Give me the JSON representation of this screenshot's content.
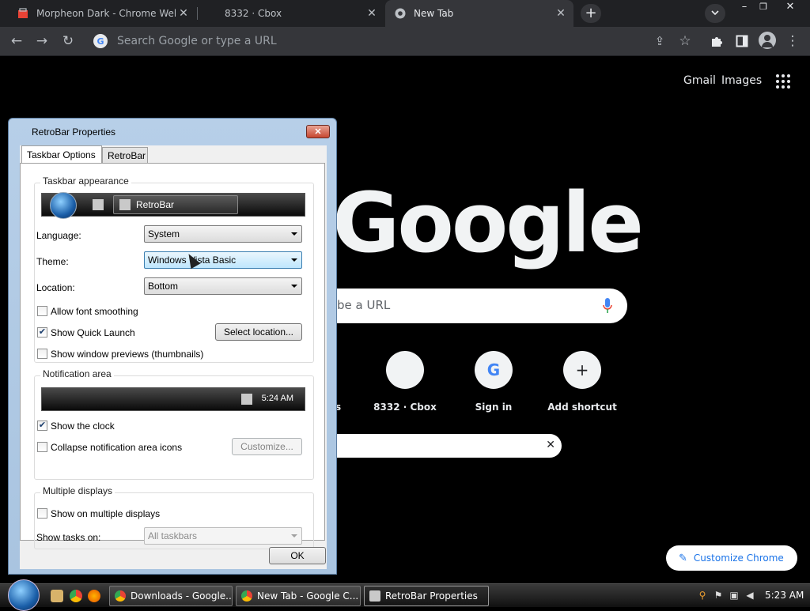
{
  "browser": {
    "tabs": [
      {
        "title": "Morpheon Dark - Chrome Web Store",
        "icon": "chrome-web-store-icon"
      },
      {
        "title": "8332 · Cbox",
        "icon": "blank-page-icon"
      },
      {
        "title": "New Tab",
        "icon": "chrome-icon"
      }
    ],
    "omnibox_placeholder": "Search Google or type a URL"
  },
  "ntp": {
    "gmail": "Gmail",
    "images": "Images",
    "logo": "Google",
    "search_placeholder_fragment": "be a URL",
    "partial_shortcut_label": "s",
    "shortcuts": [
      {
        "label": "8332 · Cbox",
        "glyph": ""
      },
      {
        "label": "Sign in",
        "glyph": "G"
      },
      {
        "label": "Add shortcut",
        "glyph": "+"
      }
    ],
    "customize_label": "Customize Chrome"
  },
  "dialog": {
    "title": "RetroBar Properties",
    "tabs": [
      "Taskbar Options",
      "RetroBar"
    ],
    "appearance": {
      "group_label": "Taskbar appearance",
      "preview_task": "RetroBar"
    },
    "language": {
      "label": "Language:",
      "value": "System"
    },
    "theme": {
      "label": "Theme:",
      "value": "Windows Vista Basic"
    },
    "location": {
      "label": "Location:",
      "value": "Bottom"
    },
    "checks": {
      "font_smoothing": {
        "label": "Allow font smoothing",
        "checked": false
      },
      "quick_launch": {
        "label": "Show Quick Launch",
        "checked": true
      },
      "previews": {
        "label": "Show window previews (thumbnails)",
        "checked": false
      }
    },
    "select_location_label": "Select location...",
    "notification": {
      "group_label": "Notification area",
      "preview_clock": "5:24 AM",
      "show_clock": {
        "label": "Show the clock",
        "checked": true
      },
      "collapse": {
        "label": "Collapse notification area icons",
        "checked": false
      },
      "customize_label": "Customize..."
    },
    "multiple": {
      "group_label": "Multiple displays",
      "show_on_multiple": {
        "label": "Show on multiple displays",
        "checked": false
      },
      "tasks_label": "Show tasks on:",
      "tasks_value": "All taskbars"
    },
    "ok_label": "OK"
  },
  "taskbar": {
    "buttons": [
      {
        "label": "Downloads - Google...",
        "icon": "chrome-icon"
      },
      {
        "label": "New Tab - Google C...",
        "icon": "chrome-icon"
      },
      {
        "label": "RetroBar Properties",
        "icon": "retrobar-icon"
      }
    ],
    "clock": "5:23 AM"
  },
  "colors": {
    "accent": "#1a73e8",
    "chrome_dark": "#35363a",
    "tab_strip": "#202124"
  }
}
